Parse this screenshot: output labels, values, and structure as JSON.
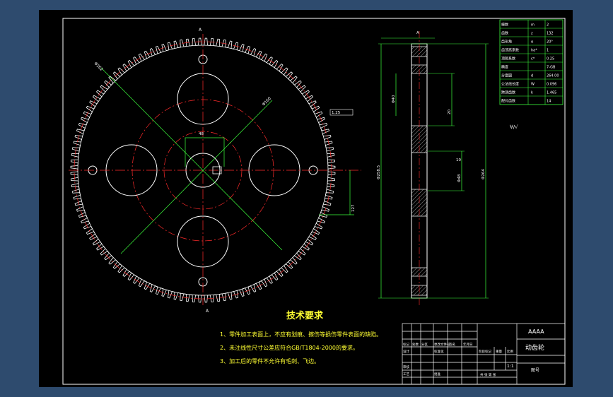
{
  "drawing": {
    "tech_title": "技术要求",
    "requirements": [
      "1、零件加工表面上，不应有划痕、擦伤等损伤零件表面的缺陷。",
      "2、未注线性尺寸公差应符合GB/T1804-2000的要求。",
      "3、加工后的零件不允许有毛刺、飞边。"
    ],
    "title_block": {
      "company": "AAAA",
      "part_name": "动齿轮",
      "drawing_no": "图号",
      "scale": "1:1",
      "headers": [
        "标记",
        "处数",
        "分区",
        "更改文件号",
        "签名",
        "年月日"
      ],
      "row_labels": [
        "设计",
        "标准化",
        "审核",
        "工艺",
        "批准"
      ],
      "stage_labels": [
        "阶段标记",
        "重量",
        "比例"
      ],
      "sheet_labels": "共 张 第 张"
    },
    "param_table": [
      [
        "模数",
        "m",
        "2"
      ],
      [
        "齿数",
        "z",
        "132"
      ],
      [
        "齿形角",
        "α",
        "20°"
      ],
      [
        "齿顶高系数",
        "ha*",
        "1"
      ],
      [
        "顶隙系数",
        "c*",
        "0.25"
      ],
      [
        "精度",
        "",
        "7-GB"
      ],
      [
        "分度圆",
        "d",
        "264.00"
      ],
      [
        "公法线长度",
        "W",
        "0.096"
      ],
      [
        "跨测齿数",
        "k",
        "1.465"
      ],
      [
        "配对齿数",
        "",
        "14"
      ]
    ],
    "dims": {
      "d1": "Φ262",
      "d2": "Φ160",
      "d3": "48",
      "d4": "1.25",
      "d5": "127",
      "d6": "Φ258.5",
      "d7": "Φ264",
      "d8": "Φ40",
      "d9": "Φ48",
      "d10": "10",
      "d11": "A",
      "d12": "20"
    }
  }
}
